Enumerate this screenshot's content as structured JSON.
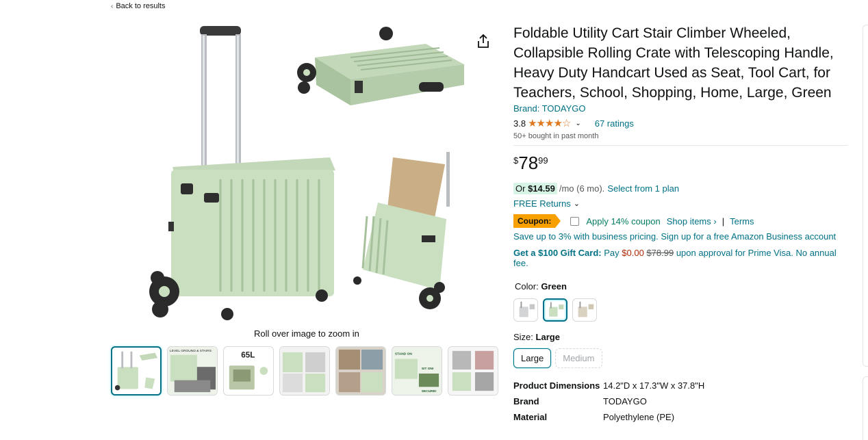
{
  "nav": {
    "back_label": "Back to results"
  },
  "gallery": {
    "zoom_hint": "Roll over image to zoom in",
    "thumb_texts": [
      "LEVEL GROUND & STAIRS",
      "65L",
      "STAND ON",
      "SIT ON!",
      "SECURE!"
    ]
  },
  "product": {
    "title": "Foldable Utility Cart Stair Climber Wheeled, Collapsible Rolling Crate with Telescoping Handle, Heavy Duty Handcart Used as Seat, Tool Cart, for Teachers, School, Shopping, Home, Large, Green",
    "brand": "Brand: TODAYGO",
    "rating": "3.8",
    "rating_fraction": 0.76,
    "ratings_count": "67 ratings",
    "bought": "50+ bought in past month"
  },
  "price": {
    "symbol": "$",
    "whole": "78",
    "fraction": "99"
  },
  "installment": {
    "prefix": "Or",
    "amount": "$14.59",
    "rest": "/mo (6 mo).",
    "link": "Select from 1 plan"
  },
  "returns": {
    "label": "FREE Returns"
  },
  "coupon": {
    "tag": "Coupon:",
    "text": "Apply 14% coupon",
    "shop": "Shop items ›",
    "separator": "|",
    "terms": "Terms"
  },
  "business": {
    "text": "Save up to 3% with business pricing. Sign up for a free Amazon Business account"
  },
  "gift": {
    "bold": "Get a $100 Gift Card:",
    "pay": "Pay",
    "zero": "$0.00",
    "strike": "$78.99",
    "rest": "upon approval for Prime Visa. No annual fee."
  },
  "color": {
    "label": "Color:",
    "value": "Green"
  },
  "size": {
    "label": "Size:",
    "value": "Large",
    "options": [
      "Large",
      "Medium"
    ]
  },
  "specs": [
    {
      "key": "Product Dimensions",
      "value": "14.2\"D x 17.3\"W x 37.8\"H"
    },
    {
      "key": "Brand",
      "value": "TODAYGO"
    },
    {
      "key": "Material",
      "value": "Polyethylene (PE)"
    }
  ],
  "colors": {
    "link": "#007185",
    "star": "#de7921",
    "cart_green": "#c9dfc0",
    "coupon": "#f7a000",
    "deal_red": "#b12704"
  }
}
